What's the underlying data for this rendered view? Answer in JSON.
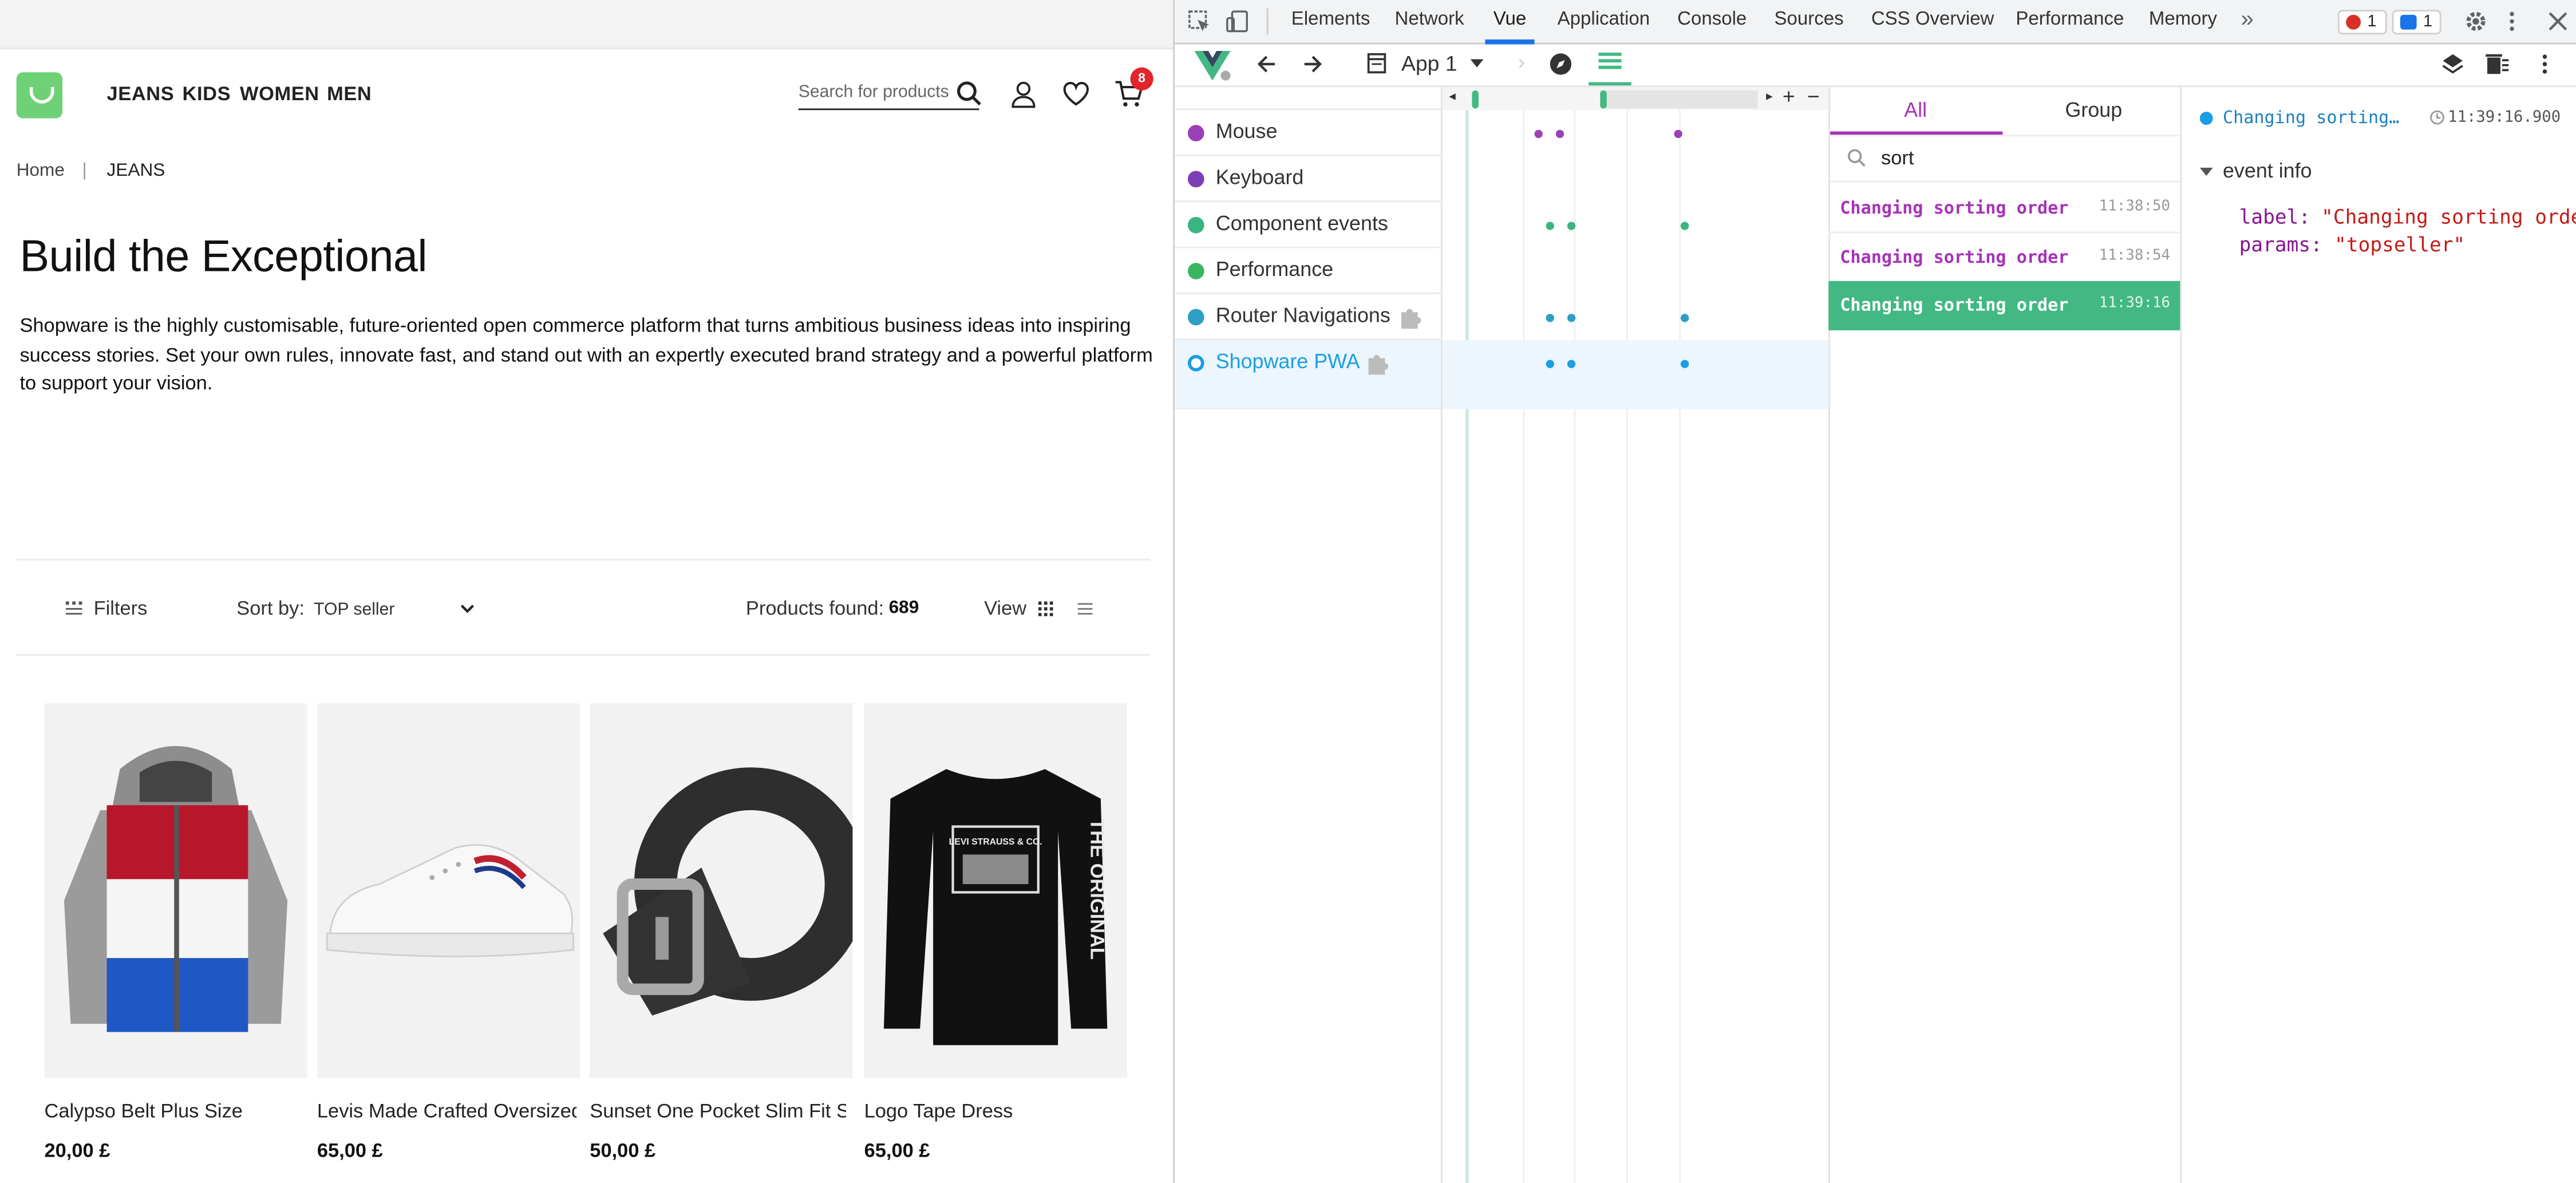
{
  "shop": {
    "nav": [
      "JEANS",
      "KIDS",
      "WOMEN",
      "MEN"
    ],
    "search_placeholder": "Search for products",
    "cart_count": "8",
    "breadcrumb": {
      "home": "Home",
      "sep": "|",
      "current": "JEANS"
    },
    "title": "Build the Exceptional",
    "description": "Shopware is the highly customisable, future-oriented open commerce platform that turns ambitious business ideas into inspiring success stories. Set your own rules, innovate fast, and stand out with an expertly executed brand strategy and a powerful platform to support your vision.",
    "toolbar": {
      "filters": "Filters",
      "sort_label": "Sort by:",
      "sort_value": "TOP seller",
      "found_label": "Products found:",
      "found_count": "689",
      "view_label": "View"
    },
    "products": [
      {
        "name": "Calypso Belt Plus Size",
        "price": "20,00 £"
      },
      {
        "name": "Levis Made Crafted Oversized",
        "price": "65,00 £"
      },
      {
        "name": "Sunset One Pocket Slim Fit S...",
        "price": "50,00 £"
      },
      {
        "name": "Logo Tape Dress",
        "price": "65,00 £"
      }
    ],
    "tee_print": {
      "top": "LEVI STRAUSS & CO.",
      "side": "THE ORIGINAL"
    }
  },
  "devtools": {
    "tabs": [
      "Elements",
      "Network",
      "Vue",
      "Application",
      "Console",
      "Sources",
      "CSS Overview",
      "Performance",
      "Memory"
    ],
    "active_tab": "Vue",
    "more": "»",
    "errors": "1",
    "messages": "1",
    "app_select": "App 1",
    "layers": [
      {
        "label": "Mouse",
        "color": "#9b41b8"
      },
      {
        "label": "Keyboard",
        "color": "#7b3fb5"
      },
      {
        "label": "Component events",
        "color": "#3ab582"
      },
      {
        "label": "Performance",
        "color": "#3ab562"
      },
      {
        "label": "Router Navigations",
        "color": "#2d9fc4"
      },
      {
        "label": "Shopware PWA",
        "color": "#1b9ee6"
      }
    ],
    "event_tabs": {
      "all": "All",
      "group": "Group"
    },
    "filter_value": "sort",
    "events": [
      {
        "name": "Changing sorting order",
        "time": "11:38:50",
        "selected": false
      },
      {
        "name": "Changing sorting order",
        "time": "11:38:54",
        "selected": false
      },
      {
        "name": "Changing sorting order",
        "time": "11:39:16",
        "selected": true
      }
    ],
    "inspector": {
      "title": "Changing sorting…",
      "time": "11:39:16.900",
      "section": "event info",
      "label_key": "label:",
      "label_val": "\"Changing sorting order\"",
      "params_key": "params:",
      "params_val": "\"topseller\""
    },
    "colors": {
      "vue_green": "#42b883",
      "accent_purple": "#a633b8",
      "string_red": "#c41a16",
      "key_purple": "#881391"
    }
  }
}
